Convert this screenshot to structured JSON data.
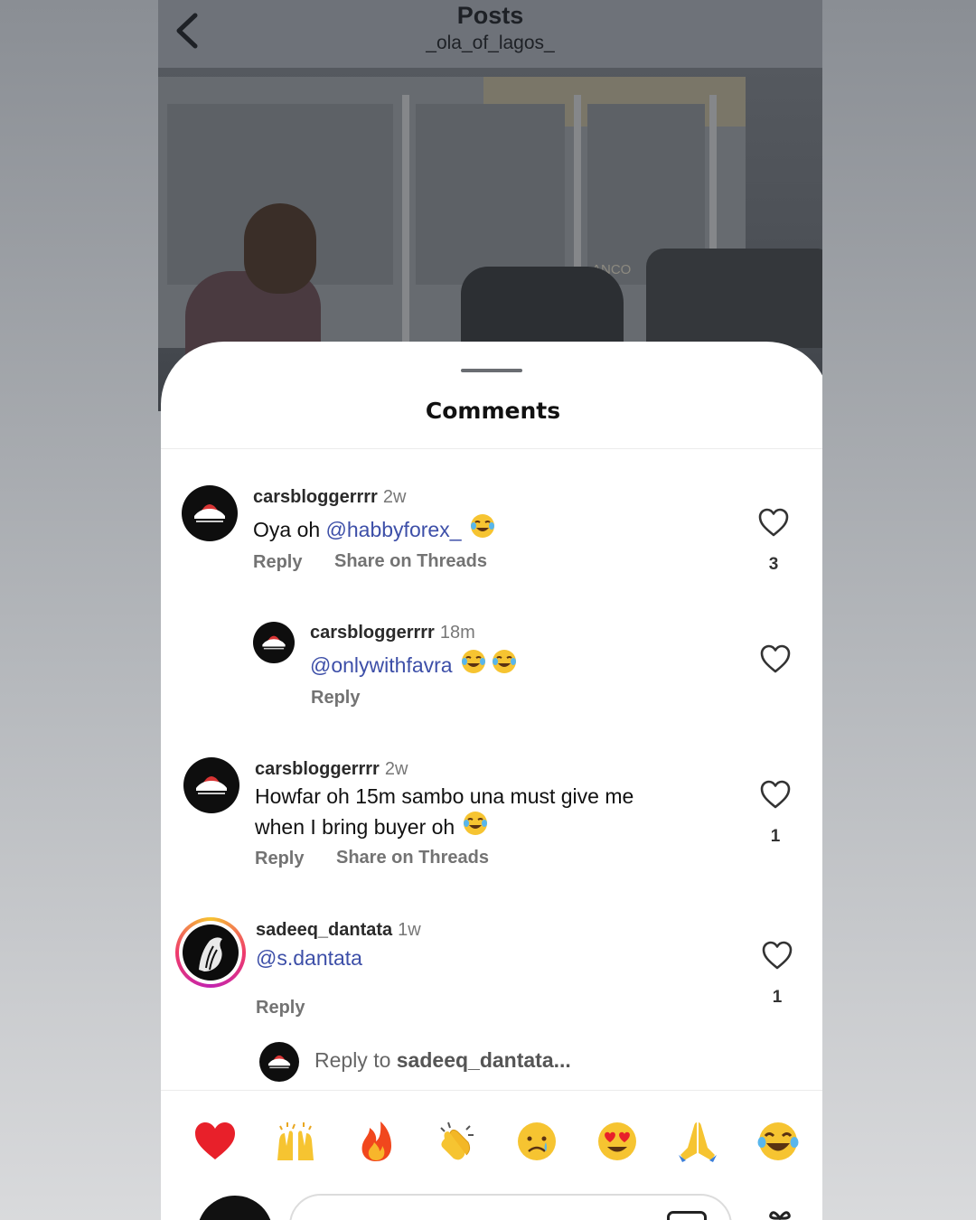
{
  "header": {
    "title": "Posts",
    "subtitle": "_ola_of_lagos_"
  },
  "video": {
    "sign_text": "ANCO"
  },
  "comments_sheet": {
    "title": "Comments",
    "comments": [
      {
        "username": "carsbloggerrrr",
        "time": "2w",
        "text_prefix": "Oya oh ",
        "mention": "@habbyforex_",
        "emoji": "laughing-tears",
        "reply_label": "Reply",
        "share_label": "Share on Threads",
        "likes": "3"
      },
      {
        "username": "carsbloggerrrr",
        "time": "18m",
        "mention": "@onlywithfavra",
        "emoji": "laughing-tears x2",
        "reply_label": "Reply"
      },
      {
        "username": "carsbloggerrrr",
        "time": "2w",
        "text_line1": "Howfar oh 15m sambo una must give me",
        "text_line2": "when I bring buyer oh",
        "emoji": "laughing-tears",
        "reply_label": "Reply",
        "share_label": "Share on Threads",
        "likes": "1"
      },
      {
        "username": "sadeeq_dantata",
        "time": "1w",
        "mention": "@s.dantata",
        "reply_label": "Reply",
        "likes": "1"
      }
    ],
    "reply_prompt_prefix": "Reply to ",
    "reply_prompt_user": "sadeeq_dantata..."
  },
  "quick_reactions": [
    "red-heart",
    "raising-hands",
    "fire",
    "clapping-hands",
    "crying-face",
    "heart-eyes",
    "folded-hands",
    "laughing-tears"
  ],
  "colors": {
    "mention": "#3d4fa8",
    "sheet_bg": "#ffffff",
    "topbar_bg": "#6e7279"
  }
}
